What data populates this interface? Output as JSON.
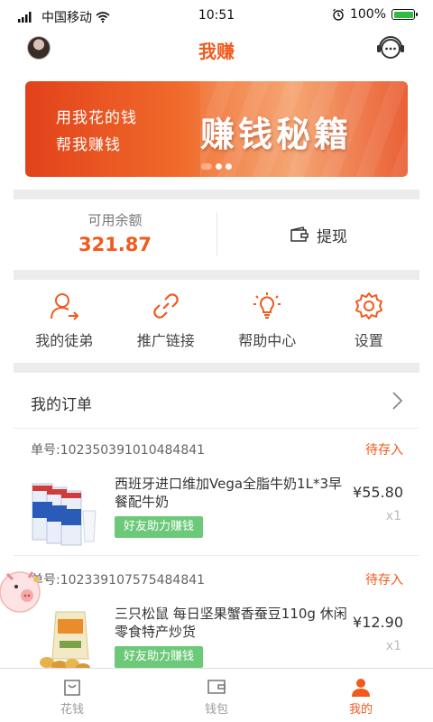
{
  "status_bar": {
    "carrier": "中国移动",
    "time": "10:51",
    "battery": "100%"
  },
  "header": {
    "title": "我赚"
  },
  "banner": {
    "line1": "用我花的钱",
    "line2": "帮我赚钱",
    "headline": "赚钱秘籍",
    "slide_count": 3,
    "active_slide": 1
  },
  "balance": {
    "label": "可用余额",
    "value": "321.87",
    "withdraw_label": "提现"
  },
  "shortcuts": [
    {
      "label": "我的徒弟",
      "icon": "user-arrow-icon"
    },
    {
      "label": "推广链接",
      "icon": "link-icon"
    },
    {
      "label": "帮助中心",
      "icon": "lightbulb-icon"
    },
    {
      "label": "设置",
      "icon": "gear-icon"
    }
  ],
  "orders": {
    "title": "我的订单",
    "items": [
      {
        "order_no": "单号:102350391010484841",
        "status": "待存入",
        "product": "西班牙进口维加Vega全脂牛奶1L*3早餐配牛奶",
        "action": "好友助力赚钱",
        "price": "¥55.80",
        "qty": "x1"
      },
      {
        "order_no": "单号:102339107575484841",
        "status": "待存入",
        "product": "三只松鼠 每日坚果蟹香蚕豆110g 休闲零食特产炒货",
        "action": "好友助力赚钱",
        "price": "¥12.90",
        "qty": "x1"
      }
    ]
  },
  "tabbar": [
    {
      "label": "花钱",
      "icon": "shopping-bag-icon",
      "active": false
    },
    {
      "label": "钱包",
      "icon": "wallet-icon",
      "active": false
    },
    {
      "label": "我的",
      "icon": "person-icon",
      "active": true
    }
  ],
  "colors": {
    "accent": "#f05a1e",
    "badge_green": "#6cc97a",
    "divider": "#ececec"
  }
}
